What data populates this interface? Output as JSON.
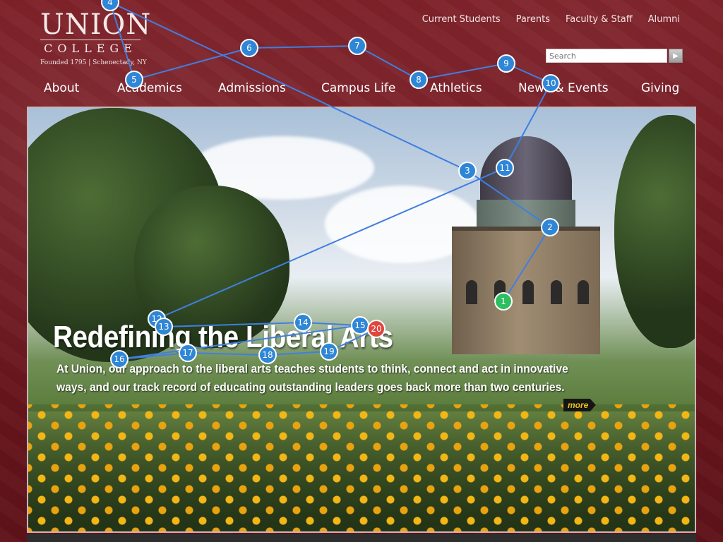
{
  "logo": {
    "name": "UNION",
    "subname": "COLLEGE",
    "founded": "Founded 1795 | Schenectady, NY"
  },
  "utility_nav": [
    "Current Students",
    "Parents",
    "Faculty & Staff",
    "Alumni"
  ],
  "search": {
    "placeholder": "Search",
    "button_icon": "play-arrow-icon"
  },
  "main_nav": [
    "About",
    "Academics",
    "Admissions",
    "Campus Life",
    "Athletics",
    "News & Events",
    "Giving"
  ],
  "hero": {
    "headline": "Redefining the Liberal Arts",
    "body": "At Union, our approach to the liberal arts teaches students to think, connect and act in innovative ways, and our track record of educating outstanding leaders goes back more than two centuries.",
    "more_label": "more"
  },
  "path_markers": [
    "1",
    "2",
    "3",
    "4",
    "5",
    "6",
    "7",
    "8",
    "9",
    "10",
    "11",
    "12",
    "13",
    "14",
    "15",
    "16",
    "17",
    "18",
    "19",
    "20"
  ],
  "colors": {
    "background": "#6d161e",
    "nav_text": "#ffffff",
    "marker": "#2f86d6",
    "marker_start": "#2ebe5f",
    "marker_end": "#e1453c",
    "path_line": "#3f7fe0"
  }
}
